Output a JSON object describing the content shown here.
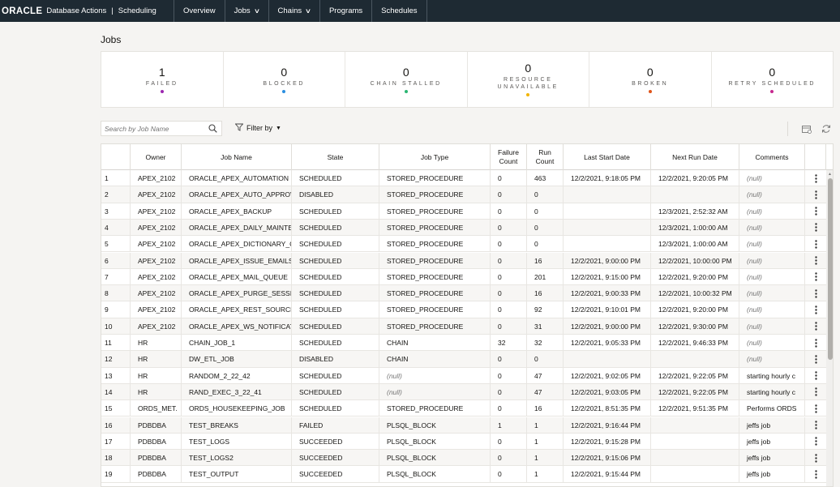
{
  "header": {
    "logo": "ORACLE",
    "app_title": "Database Actions",
    "separator": "|",
    "section": "Scheduling",
    "nav": [
      "Overview",
      "Jobs",
      "Chains",
      "Programs",
      "Schedules"
    ]
  },
  "page": {
    "title": "Jobs"
  },
  "summary": [
    {
      "count": "1",
      "label": "FAILED",
      "color": "#9c27b0"
    },
    {
      "count": "0",
      "label": "BLOCKED",
      "color": "#2a8ee0"
    },
    {
      "count": "0",
      "label": "CHAIN STALLED",
      "color": "#2bb673"
    },
    {
      "count": "0",
      "label": "RESOURCE",
      "label2": "UNAVAILABLE",
      "color": "#f2b500"
    },
    {
      "count": "0",
      "label": "BROKEN",
      "color": "#e0541a"
    },
    {
      "count": "0",
      "label": "RETRY SCHEDULED",
      "color": "#c6288f"
    }
  ],
  "toolbar": {
    "search_placeholder": "Search by Job Name",
    "filter_label": "Filter by"
  },
  "columns": [
    {
      "label": "",
      "w": 36
    },
    {
      "label": "Owner",
      "w": 63
    },
    {
      "label": "Job Name",
      "w": 136
    },
    {
      "label": "State",
      "w": 108
    },
    {
      "label": "Job Type",
      "w": 137
    },
    {
      "label": "Failure\nCount",
      "w": 45
    },
    {
      "label": "Run\nCount",
      "w": 45
    },
    {
      "label": "Last Start Date",
      "w": 108
    },
    {
      "label": "Next Run Date",
      "w": 109
    },
    {
      "label": "Comments",
      "w": 81
    },
    {
      "label": "",
      "w": 26
    }
  ],
  "rows": [
    [
      "1",
      "APEX_2102",
      "ORACLE_APEX_AUTOMATION",
      "SCHEDULED",
      "STORED_PROCEDURE",
      "0",
      "463",
      "12/2/2021, 9:18:05 PM",
      "12/2/2021, 9:20:05 PM",
      "(null)"
    ],
    [
      "2",
      "APEX_2102",
      "ORACLE_APEX_AUTO_APPROV",
      "DISABLED",
      "STORED_PROCEDURE",
      "0",
      "0",
      "",
      "",
      "(null)"
    ],
    [
      "3",
      "APEX_2102",
      "ORACLE_APEX_BACKUP",
      "SCHEDULED",
      "STORED_PROCEDURE",
      "0",
      "0",
      "",
      "12/3/2021, 2:52:32 AM",
      "(null)"
    ],
    [
      "4",
      "APEX_2102",
      "ORACLE_APEX_DAILY_MAINTE",
      "SCHEDULED",
      "STORED_PROCEDURE",
      "0",
      "0",
      "",
      "12/3/2021, 1:00:00 AM",
      "(null)"
    ],
    [
      "5",
      "APEX_2102",
      "ORACLE_APEX_DICTIONARY_C",
      "SCHEDULED",
      "STORED_PROCEDURE",
      "0",
      "0",
      "",
      "12/3/2021, 1:00:00 AM",
      "(null)"
    ],
    [
      "6",
      "APEX_2102",
      "ORACLE_APEX_ISSUE_EMAILS",
      "SCHEDULED",
      "STORED_PROCEDURE",
      "0",
      "16",
      "12/2/2021, 9:00:00 PM",
      "12/2/2021, 10:00:00 PM",
      "(null)"
    ],
    [
      "7",
      "APEX_2102",
      "ORACLE_APEX_MAIL_QUEUE",
      "SCHEDULED",
      "STORED_PROCEDURE",
      "0",
      "201",
      "12/2/2021, 9:15:00 PM",
      "12/2/2021, 9:20:00 PM",
      "(null)"
    ],
    [
      "8",
      "APEX_2102",
      "ORACLE_APEX_PURGE_SESSIC",
      "SCHEDULED",
      "STORED_PROCEDURE",
      "0",
      "16",
      "12/2/2021, 9:00:33 PM",
      "12/2/2021, 10:00:32 PM",
      "(null)"
    ],
    [
      "9",
      "APEX_2102",
      "ORACLE_APEX_REST_SOURCE_",
      "SCHEDULED",
      "STORED_PROCEDURE",
      "0",
      "92",
      "12/2/2021, 9:10:01 PM",
      "12/2/2021, 9:20:00 PM",
      "(null)"
    ],
    [
      "10",
      "APEX_2102",
      "ORACLE_APEX_WS_NOTIFICAT",
      "SCHEDULED",
      "STORED_PROCEDURE",
      "0",
      "31",
      "12/2/2021, 9:00:00 PM",
      "12/2/2021, 9:30:00 PM",
      "(null)"
    ],
    [
      "11",
      "HR",
      "CHAIN_JOB_1",
      "SCHEDULED",
      "CHAIN",
      "32",
      "32",
      "12/2/2021, 9:05:33 PM",
      "12/2/2021, 9:46:33 PM",
      "(null)"
    ],
    [
      "12",
      "HR",
      "DW_ETL_JOB",
      "DISABLED",
      "CHAIN",
      "0",
      "0",
      "",
      "",
      "(null)"
    ],
    [
      "13",
      "HR",
      "RANDOM_2_22_42",
      "SCHEDULED",
      "(null)",
      "0",
      "47",
      "12/2/2021, 9:02:05 PM",
      "12/2/2021, 9:22:05 PM",
      "starting hourly c"
    ],
    [
      "14",
      "HR",
      "RAND_EXEC_3_22_41",
      "SCHEDULED",
      "(null)",
      "0",
      "47",
      "12/2/2021, 9:03:05 PM",
      "12/2/2021, 9:22:05 PM",
      "starting hourly c"
    ],
    [
      "15",
      "ORDS_MET.",
      "ORDS_HOUSEKEEPING_JOB",
      "SCHEDULED",
      "STORED_PROCEDURE",
      "0",
      "16",
      "12/2/2021, 8:51:35 PM",
      "12/2/2021, 9:51:35 PM",
      "Performs ORDS"
    ],
    [
      "16",
      "PDBDBA",
      "TEST_BREAKS",
      "FAILED",
      "PLSQL_BLOCK",
      "1",
      "1",
      "12/2/2021, 9:16:44 PM",
      "",
      "jeffs job"
    ],
    [
      "17",
      "PDBDBA",
      "TEST_LOGS",
      "SUCCEEDED",
      "PLSQL_BLOCK",
      "0",
      "1",
      "12/2/2021, 9:15:28 PM",
      "",
      "jeffs job"
    ],
    [
      "18",
      "PDBDBA",
      "TEST_LOGS2",
      "SUCCEEDED",
      "PLSQL_BLOCK",
      "0",
      "1",
      "12/2/2021, 9:15:06 PM",
      "",
      "jeffs job"
    ],
    [
      "19",
      "PDBDBA",
      "TEST_OUTPUT",
      "SUCCEEDED",
      "PLSQL_BLOCK",
      "0",
      "1",
      "12/2/2021, 9:15:44 PM",
      "",
      "jeffs job"
    ]
  ]
}
